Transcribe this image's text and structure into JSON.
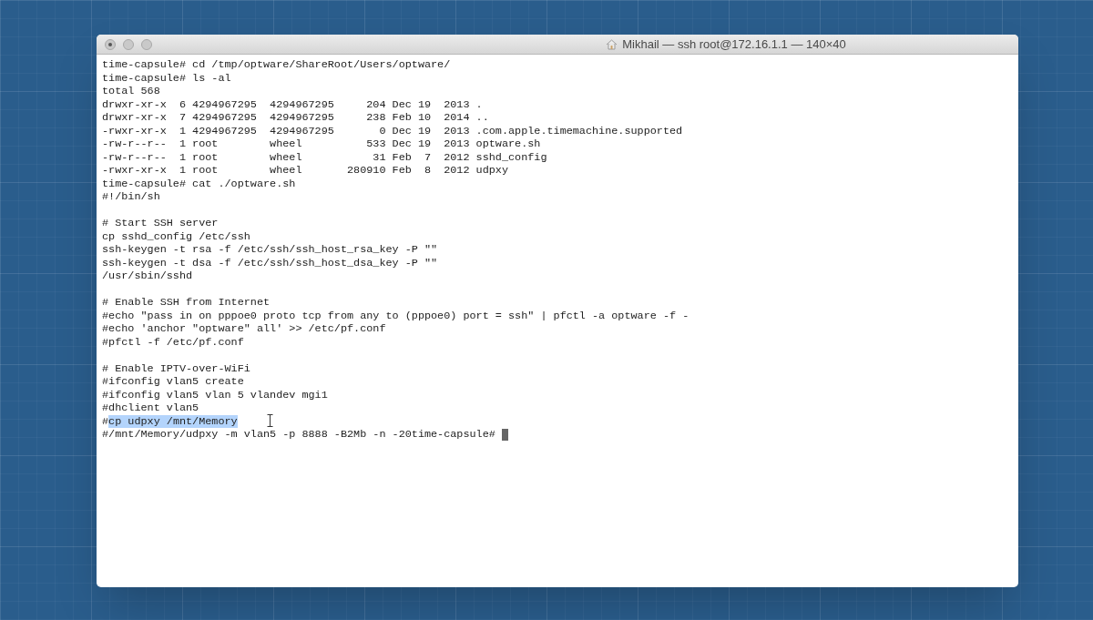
{
  "window": {
    "title": "Mikhail — ssh root@172.16.1.1 — 140×40"
  },
  "terminal": {
    "cursor_visible": true,
    "lines": [
      {
        "kind": "plain",
        "text": "time-capsule# cd /tmp/optware/ShareRoot/Users/optware/"
      },
      {
        "kind": "plain",
        "text": "time-capsule# ls -al"
      },
      {
        "kind": "plain",
        "text": "total 568"
      },
      {
        "kind": "plain",
        "text": "drwxr-xr-x  6 4294967295  4294967295     204 Dec 19  2013 ."
      },
      {
        "kind": "plain",
        "text": "drwxr-xr-x  7 4294967295  4294967295     238 Feb 10  2014 .."
      },
      {
        "kind": "plain",
        "text": "-rwxr-xr-x  1 4294967295  4294967295       0 Dec 19  2013 .com.apple.timemachine.supported"
      },
      {
        "kind": "plain",
        "text": "-rw-r--r--  1 root        wheel          533 Dec 19  2013 optware.sh"
      },
      {
        "kind": "plain",
        "text": "-rw-r--r--  1 root        wheel           31 Feb  7  2012 sshd_config"
      },
      {
        "kind": "plain",
        "text": "-rwxr-xr-x  1 root        wheel       280910 Feb  8  2012 udpxy"
      },
      {
        "kind": "plain",
        "text": "time-capsule# cat ./optware.sh"
      },
      {
        "kind": "plain",
        "text": "#!/bin/sh"
      },
      {
        "kind": "blank"
      },
      {
        "kind": "plain",
        "text": "# Start SSH server"
      },
      {
        "kind": "plain",
        "text": "cp sshd_config /etc/ssh"
      },
      {
        "kind": "plain",
        "text": "ssh-keygen -t rsa -f /etc/ssh/ssh_host_rsa_key -P \"\""
      },
      {
        "kind": "plain",
        "text": "ssh-keygen -t dsa -f /etc/ssh/ssh_host_dsa_key -P \"\""
      },
      {
        "kind": "plain",
        "text": "/usr/sbin/sshd"
      },
      {
        "kind": "blank"
      },
      {
        "kind": "plain",
        "text": "# Enable SSH from Internet"
      },
      {
        "kind": "plain",
        "text": "#echo \"pass in on pppoe0 proto tcp from any to (pppoe0) port = ssh\" | pfctl -a optware -f -"
      },
      {
        "kind": "plain",
        "text": "#echo 'anchor \"optware\" all' >> /etc/pf.conf"
      },
      {
        "kind": "plain",
        "text": "#pfctl -f /etc/pf.conf"
      },
      {
        "kind": "blank"
      },
      {
        "kind": "plain",
        "text": "# Enable IPTV-over-WiFi"
      },
      {
        "kind": "plain",
        "text": "#ifconfig vlan5 create"
      },
      {
        "kind": "plain",
        "text": "#ifconfig vlan5 vlan 5 vlandev mgi1"
      },
      {
        "kind": "plain",
        "text": "#dhclient vlan5"
      },
      {
        "kind": "mixed",
        "segments": [
          {
            "text": "#",
            "selected": false
          },
          {
            "text": "cp udpxy /mnt/Memory",
            "selected": true
          }
        ]
      },
      {
        "kind": "plain",
        "text": "#/mnt/Memory/udpxy -m vlan5 -p 8888 -B2Mb -n -20time-capsule#"
      }
    ]
  }
}
